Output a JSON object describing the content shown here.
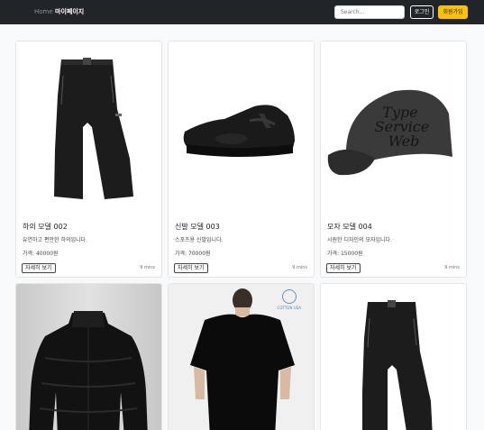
{
  "nav": {
    "home": "Home",
    "mypage": "마이페이지",
    "search_placeholder": "Search...",
    "login": "로그인",
    "signup": "회원가입"
  },
  "products": [
    {
      "title": "하의 모델 002",
      "desc": "유연하고 편안한 하의입니다.",
      "price": "가격: 40000원",
      "button": "자세히 보기",
      "time": "9 mins",
      "icon": "pants-icon"
    },
    {
      "title": "신발 모델 003",
      "desc": "스포츠용 신발입니다.",
      "price": "가격: 70000원",
      "button": "자세히 보기",
      "time": "9 mins",
      "icon": "sneaker-icon"
    },
    {
      "title": "모자 모델 004",
      "desc": "시원한 디자인의 모자입니다.",
      "price": "가격: 15000원",
      "button": "자세히 보기",
      "time": "9 mins",
      "icon": "cap-icon"
    },
    {
      "icon": "puffer-jacket-icon"
    },
    {
      "icon": "tshirt-icon",
      "badge": "COTTON USA"
    },
    {
      "icon": "pants-icon"
    }
  ],
  "cap_print": "Type Service Web",
  "colors": {
    "navbar": "#212529",
    "signup": "#ffc107",
    "background": "#f8f9fa"
  }
}
